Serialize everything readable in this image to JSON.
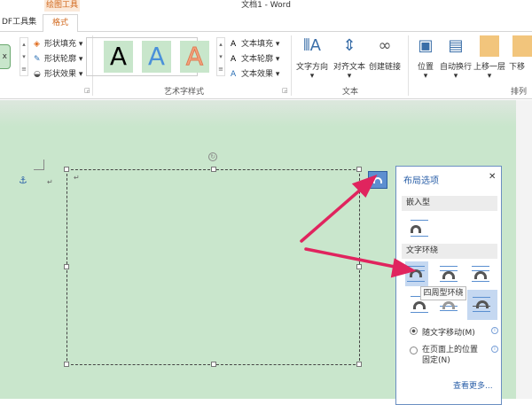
{
  "window": {
    "title": "文档1 - Word",
    "context_tab": "绘图工具"
  },
  "tabs": [
    {
      "label": "DF工具集"
    },
    {
      "label": "格式",
      "active": true
    }
  ],
  "ribbon": {
    "shape_styles": {
      "fill": "形状填充",
      "outline": "形状轮廓",
      "effects": "形状效果"
    },
    "wordart": {
      "label": "艺术字样式",
      "samples": [
        "A",
        "A",
        "A"
      ],
      "fill": "文本填充",
      "outline": "文本轮廓",
      "effects": "文本效果"
    },
    "text": {
      "label": "文本",
      "direction": "文字方向",
      "align": "对齐文本",
      "link": "创建链接"
    },
    "arrange": {
      "label": "排列",
      "position": "位置",
      "wrap": "自动换行",
      "forward": "上移一层",
      "backward": "下移"
    }
  },
  "layout_panel": {
    "title": "布局选项",
    "close": "✕",
    "inline_header": "嵌入型",
    "wrap_header": "文字环绕",
    "tooltip": "四周型环绕",
    "move_with_text": "随文字移动(M)",
    "fix_position": "在页面上的位置固定(N)",
    "see_more": "查看更多...",
    "selected_option": "move_with_text"
  },
  "colors": {
    "accent": "#d2691e",
    "doc_bg": "#c9e6cc",
    "arrow": "#e0245e",
    "link": "#2a5fa8"
  }
}
